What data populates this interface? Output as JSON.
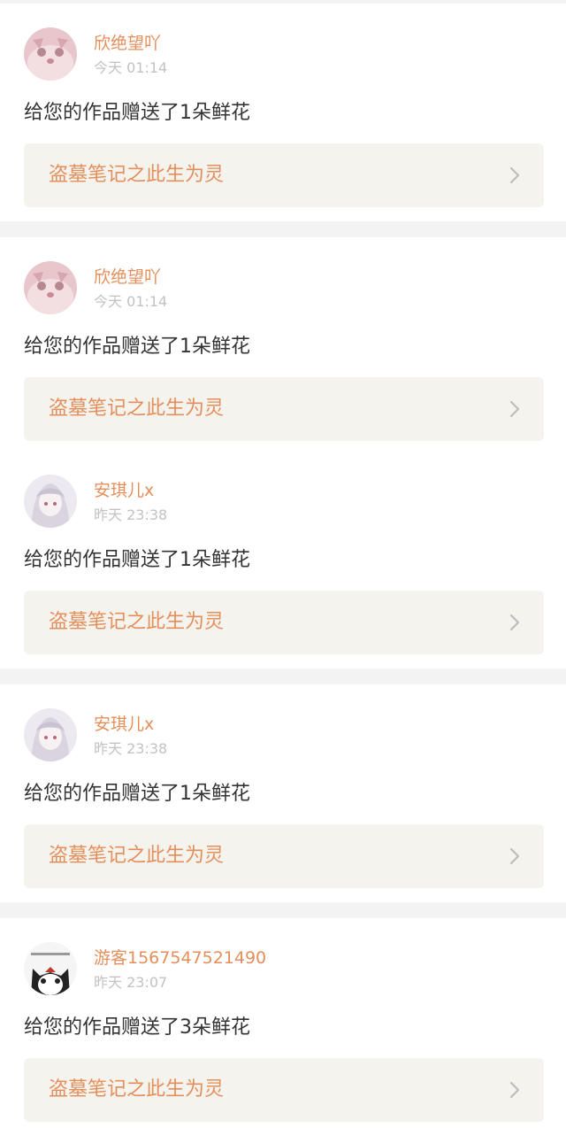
{
  "notifications": [
    {
      "user": "欣绝望吖",
      "time": "今天 01:14",
      "message": "给您的作品赠送了1朵鲜花",
      "work_title": "盗墓笔记之此生为灵",
      "avatar_icon": "pink-cat-avatar"
    },
    {
      "user": "欣绝望吖",
      "time": "今天 01:14",
      "message": "给您的作品赠送了1朵鲜花",
      "work_title": "盗墓笔记之此生为灵",
      "avatar_icon": "pink-cat-avatar"
    },
    {
      "user": "安琪儿x",
      "time": "昨天 23:38",
      "message": "给您的作品赠送了1朵鲜花",
      "work_title": "盗墓笔记之此生为灵",
      "avatar_icon": "anime-girl-avatar"
    },
    {
      "user": "安琪儿x",
      "time": "昨天 23:38",
      "message": "给您的作品赠送了1朵鲜花",
      "work_title": "盗墓笔记之此生为灵",
      "avatar_icon": "anime-girl-avatar"
    },
    {
      "user": "游客1567547521490",
      "time": "昨天 23:07",
      "message": "给您的作品赠送了3朵鲜花",
      "work_title": "盗墓笔记之此生为灵",
      "avatar_icon": "black-white-cat-avatar"
    }
  ],
  "colors": {
    "accent": "#e48f5b",
    "timestamp": "#c2c2c2",
    "message_text": "#333333",
    "link_box_bg": "#f4f3ee",
    "separator": "#f3f3f3"
  }
}
